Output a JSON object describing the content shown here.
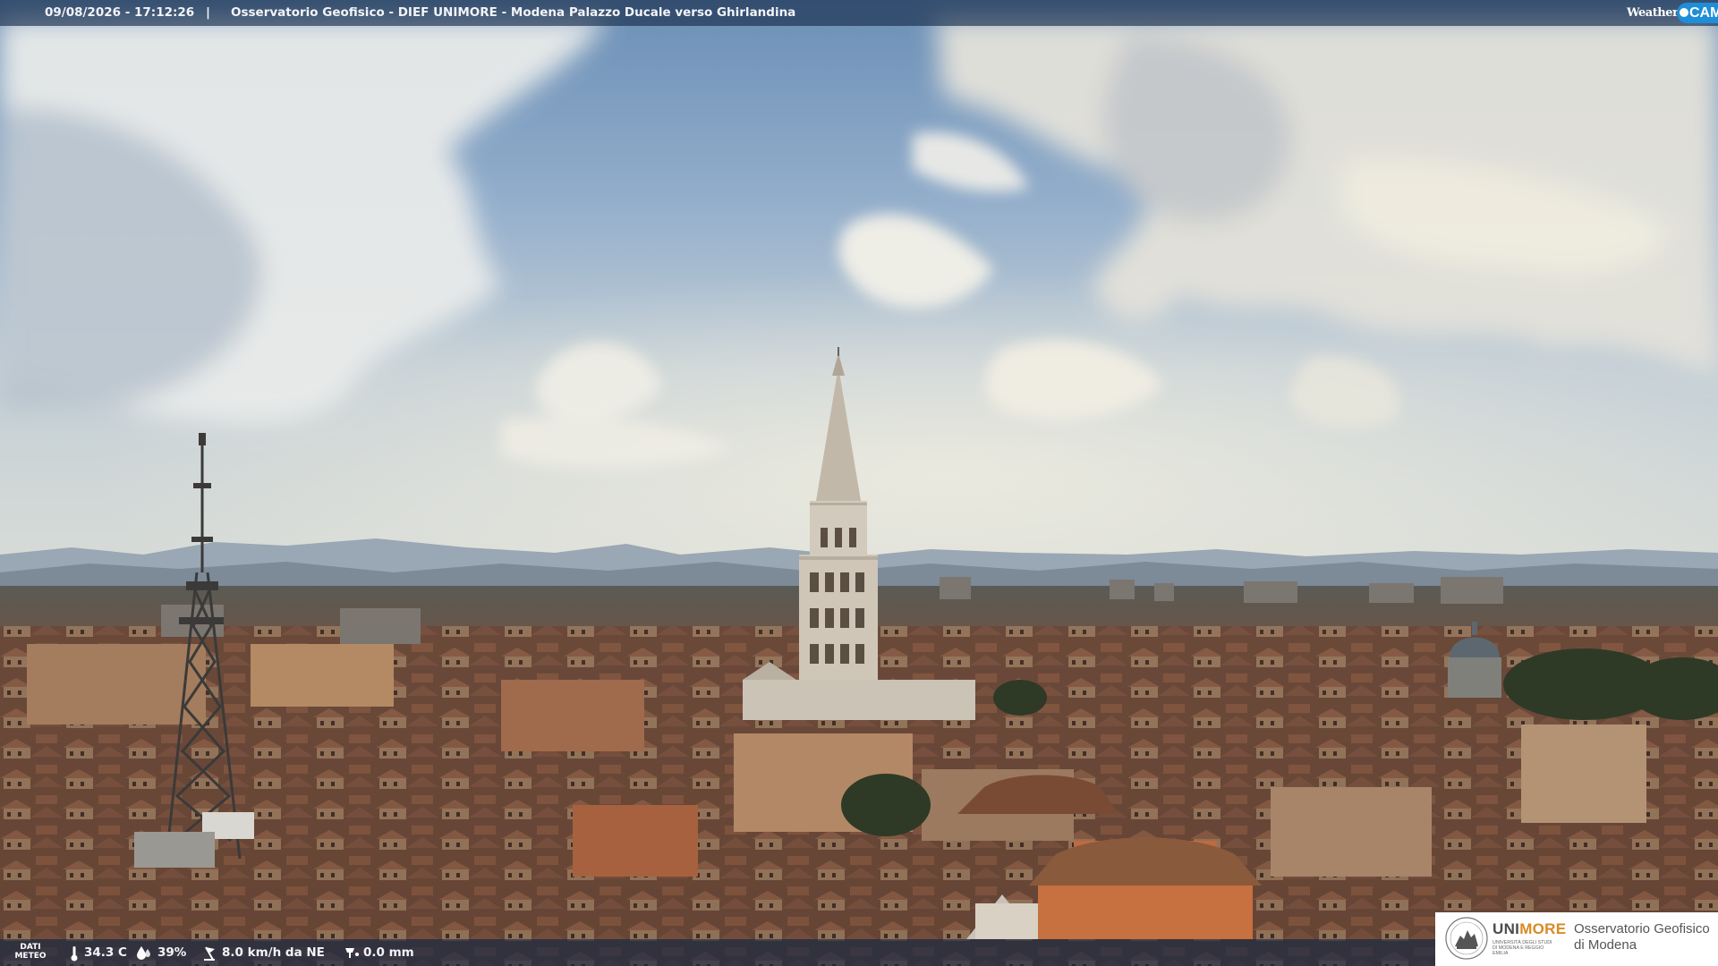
{
  "header": {
    "timestamp": "09/08/2026 - 17:12:26",
    "separator": "|",
    "location": "Osservatorio Geofisico - DIEF UNIMORE - Modena Palazzo Ducale verso Ghirlandina",
    "brand_prefix": "Weather",
    "brand_cam": "CAM"
  },
  "footer": {
    "dati_label": "DATI",
    "meteo_label": "METEO",
    "temperature": "34.3 C",
    "humidity": "39%",
    "wind": "8.0 km/h da NE",
    "rain": "0.0 mm",
    "icons": [
      "thermometer-icon",
      "humidity-drop-icon",
      "wind-icon",
      "rain-gauge-icon"
    ]
  },
  "logo": {
    "uni_part1": "UNI",
    "uni_part2": "MORE",
    "uni_subtitle": "UNIVERSITÀ DEGLI STUDI DI MODENA E REGGIO EMILIA",
    "obs_line1": "Osservatorio Geofisico",
    "obs_line2": "di Modena"
  },
  "colors": {
    "bar": "#122646",
    "brand_cam": "#1e8ed8",
    "unimore_orange": "#d98a23",
    "unimore_gray": "#4d4d4d"
  }
}
